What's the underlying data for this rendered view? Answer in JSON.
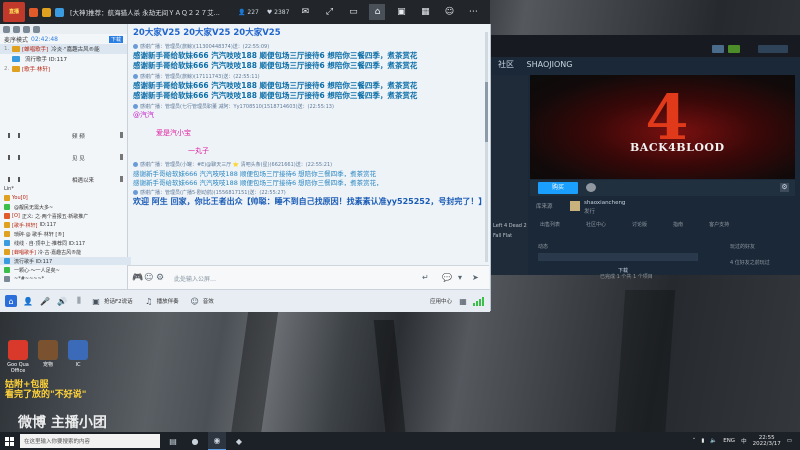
{
  "topbar": {
    "logo_text": "直播",
    "room_title": "[大神]推荐：航海猎人杀 永劫无间ＹＡＱ２２７艾...",
    "viewers": "227",
    "fans": "2387"
  },
  "left_panel": {
    "mode_label": "麦序模式",
    "mode_time": "02:42:48",
    "download_label": "下载",
    "queue": [
      {
        "n": "1.",
        "tag_color": "#e0a020",
        "name": "[蝉唱歌手]",
        "msg": "冷炎·\"嘉趣古风®能"
      },
      {
        "n": "",
        "tag_color": "#3a9be0",
        "name": "",
        "msg": "流行歌手 ID:117"
      },
      {
        "n": "2.",
        "tag_color": "#e0a020",
        "name": "[歌手·林轩]",
        "msg": ""
      }
    ],
    "roll_a": {
      "mid": "频 频",
      "bars": true
    },
    "roll_b": {
      "mid": "见 见"
    },
    "roll_c": {
      "mid": "相遇以来"
    },
    "online_count": "Lin*",
    "members": [
      {
        "dot": "#e0a020",
        "name": "You[0]",
        "msg": ""
      },
      {
        "dot": "#3bbf4a",
        "name": "",
        "msg": "@靓民无需大多~"
      },
      {
        "dot": "#e05a2a",
        "name": "[O]",
        "msg": "正义: 之·两个喜报五·新歌推广"
      },
      {
        "dot": "#e0a020",
        "name": "[歌手·林轩]",
        "msg": "ID:117"
      },
      {
        "dot": "#e0a020",
        "name": "",
        "msg": "琐碎·@ 歌手·林轩 [®]"
      },
      {
        "dot": "#3a9be0",
        "name": "",
        "msg": "线线 · 自·顶中上·推荐同 ID:117"
      },
      {
        "dot": "#e0a020",
        "name": "[蝉唱歌手]",
        "msg": "冷·古·嘉趣古风®能"
      },
      {
        "dot": "#3a9be0",
        "name": "",
        "msg": "流行歌手 ID:117"
      },
      {
        "dot": "#3bbf4a",
        "name": "",
        "msg": "一颗心·～一人足矣~"
      },
      {
        "dot": "#7a8896",
        "name": "",
        "msg": "~*#~~~~*"
      }
    ]
  },
  "messages": {
    "banner": "20大家V25  20大家V25  20大家V25",
    "meta1": "感谢广播：管理员(旅鲸)(11300448374)送：(22:55:09)",
    "thanks_bold": [
      "感谢新手哥给软妹666 汽汽吱吱188 顺便包场三厅接待6 想陪你三餐四季，煮茶赏花",
      "感谢新手哥给软妹666 汽汽吱吱188 顺便包场三厅接待6 想陪你三餐四季，煮茶赏花"
    ],
    "meta2": "感谢广播：管理员(旅鲸)(17111743)送：(22:55:11)",
    "thanks_bold2": [
      "感谢新手哥给软妹666 汽汽吱吱188 顺便包场三厅接待6 想陪你三餐四季，煮茶赏花",
      "感谢新手哥给软妹666 汽汽吱吱188 顺便包场三厅接待6 想陪你三餐四季，煮茶赏花"
    ],
    "meta3": "感谢广播：管理员(七行管理员职董 减阿：Yy1708510(1518714603)送：(22:55:13)",
    "purple_line": "@汽汽",
    "pink_line1": "爱是汽小宝",
    "pink_line2": "一丸子",
    "meta4": "感谢广播：管理员(小罐：#E)@聊天三厅 ⭐ 清吧头条(星)(6621661)送：(22:55:21)",
    "thanks_light": [
      "感谢新手哥给软妹666 汽汽吱吱188 顺便包场三厅接待6 想陪你三餐四季，煮茶赏花",
      "感谢新手哥给软妹666 汽汽吱吱188 顺便包场三厅接待6 想陪你三餐四季，煮茶赏花，"
    ],
    "meta5": "感谢广播：管理员(广播5·剧动鸽)(1556817151)送：(22:55:27)",
    "welcome": "欢迎 阿生 回家，你比王者出众【帅聪：睡不到自己找原因！找素素认准yy525252，号封完了！】"
  },
  "input": {
    "placeholder": "此处输入公屏…"
  },
  "toolbar": {
    "record_label": "抢话F2说话",
    "music_label": "播放伴奏",
    "fx_label": "音效",
    "app_label": "应用中心"
  },
  "steam": {
    "nav_community": "社区",
    "nav_user": "SHAOJIONG",
    "hero_title": "BACK4BLOOD",
    "buy_label": "购买",
    "dev_label": "库来源",
    "dev_name": "shaoxiancheng",
    "dev_sub": "发行",
    "tab_labels": [
      "出售列表",
      "社区中心",
      "讨论版",
      "指南",
      "客户支持"
    ],
    "activity_label": "动态",
    "friends_label": "玩过的好友",
    "download_label": "下载",
    "download_sub": "已完成 1 个共 1 个项目",
    "friends_count": "4 位好友之前玩过",
    "lib_item": "Left 4 Dead 2",
    "lib_item2": "Fall Flat"
  },
  "desktop": {
    "icons": [
      {
        "label": "Goo Qua Office",
        "color": "#d8392b"
      },
      {
        "label": "宠物",
        "color": "#7a5230"
      },
      {
        "label": "IC",
        "color": "#3a6ab8"
      }
    ],
    "promo_line1": "姑附+包服",
    "promo_line2": "看完了放的\"不好说\"",
    "weibo_text": "微博 主播小团"
  },
  "taskbar": {
    "search_placeholder": "在这里输入你要搜索的内容",
    "lang": "ENG",
    "time": "22:55",
    "date": "2022/3/17"
  }
}
